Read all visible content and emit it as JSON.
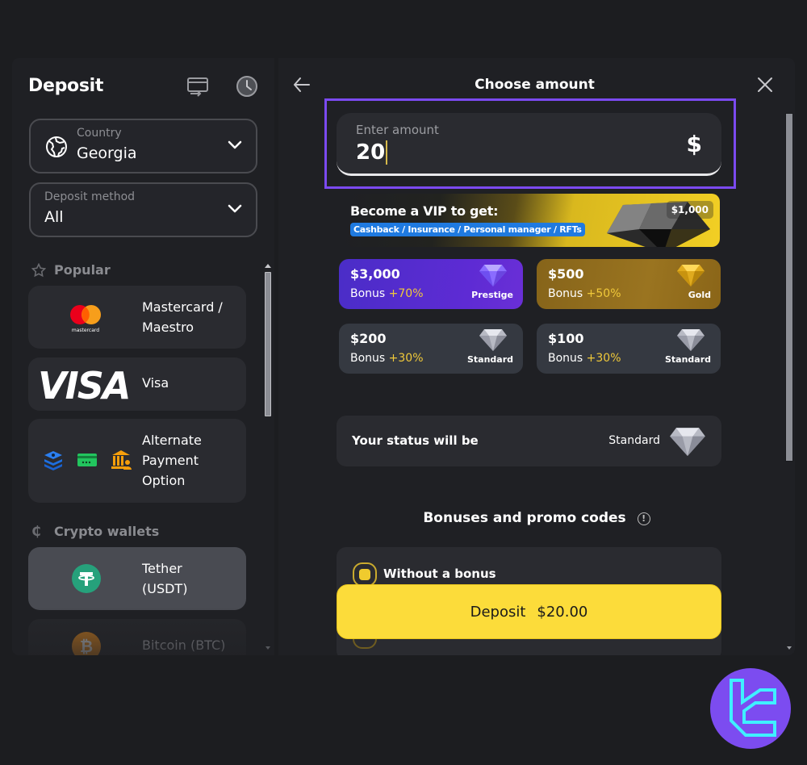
{
  "sidebar": {
    "title": "Deposit",
    "icons": {
      "transfer": "card-transfer-icon",
      "history": "clock-history-icon"
    },
    "country": {
      "label": "Country",
      "value": "Georgia",
      "icon": "globe-icon"
    },
    "deposit_method": {
      "label": "Deposit method",
      "value": "All"
    },
    "sections": [
      {
        "title": "Popular",
        "icon": "star-icon",
        "items": [
          {
            "label": "Mastercard / Maestro",
            "label_lines": [
              "Mastercard /",
              "Maestro"
            ],
            "logo": "mastercard-logo",
            "logo_text": "mastercard"
          },
          {
            "label": "Visa",
            "logo": "visa-logo",
            "logo_text": "VISA"
          },
          {
            "label": "Alternate Payment Option",
            "label_lines": [
              "Alternate",
              "Payment",
              "Option"
            ],
            "icons": [
              "layers-icon",
              "card-icon",
              "bank-icon"
            ]
          }
        ]
      },
      {
        "title": "Crypto wallets",
        "icon": "crypto-icon",
        "icon_glyph": "₵",
        "items": [
          {
            "label": "Tether (USDT)",
            "label_lines": [
              "Tether",
              "(USDT)"
            ],
            "logo": "tether-logo",
            "selected": true
          },
          {
            "label": "Bitcoin (BTC)",
            "logo": "bitcoin-logo"
          }
        ]
      }
    ]
  },
  "main": {
    "title": "Choose amount",
    "amount_input": {
      "label": "Enter amount",
      "value": "20",
      "currency": "$"
    },
    "vip_banner": {
      "title": "Become a VIP to get:",
      "perks": "Cashback / Insurance / Personal manager / RFTs",
      "amount": "$1,000"
    },
    "tiers": [
      {
        "amount": "$3,000",
        "bonus_label": "Bonus",
        "bonus_pct": "+70%",
        "name": "Prestige",
        "color": "#5a2fd2"
      },
      {
        "amount": "$500",
        "bonus_label": "Bonus",
        "bonus_pct": "+50%",
        "name": "Gold",
        "color": "#946f1d"
      },
      {
        "amount": "$200",
        "bonus_label": "Bonus",
        "bonus_pct": "+30%",
        "name": "Standard",
        "color": "#353941"
      },
      {
        "amount": "$100",
        "bonus_label": "Bonus",
        "bonus_pct": "+30%",
        "name": "Standard",
        "color": "#353941"
      }
    ],
    "status": {
      "label": "Your status will be",
      "value": "Standard"
    },
    "promo": {
      "title": "Bonuses and promo codes",
      "info_glyph": "!"
    },
    "bonus_options": [
      {
        "label": "Without a bonus",
        "selected": true
      }
    ],
    "deposit_button": {
      "label": "Deposit",
      "amount": "$20.00"
    }
  },
  "colors": {
    "accent_yellow": "#fcdc3a",
    "highlight_purple": "#7b4af0",
    "bonus_pct": "#f0c93a",
    "perks_blue": "#1f7ae0"
  }
}
